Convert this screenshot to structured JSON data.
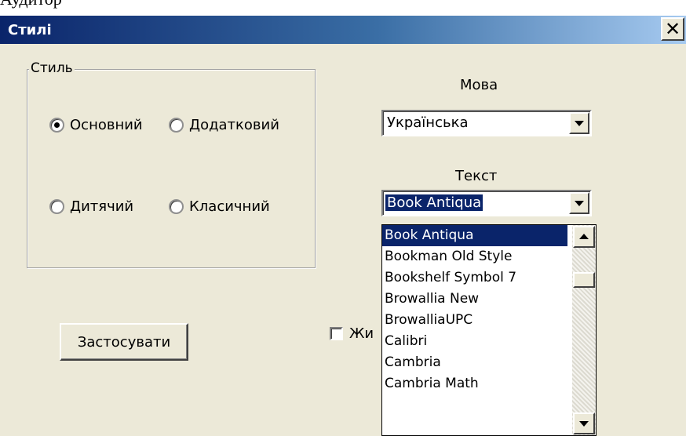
{
  "top_fragment": "Аудитор",
  "window": {
    "title": "Стилі",
    "close_glyph": "✕"
  },
  "style_group": {
    "legend": "Стиль",
    "options": [
      {
        "label": "Основний",
        "checked": true
      },
      {
        "label": "Додатковий",
        "checked": false
      },
      {
        "label": "Дитячий",
        "checked": false
      },
      {
        "label": "Класичний",
        "checked": false
      }
    ]
  },
  "language": {
    "label": "Мова",
    "value": "Українська"
  },
  "text_font": {
    "label": "Текст",
    "value": "Book Antiqua",
    "options": [
      "Book Antiqua",
      "Bookman Old Style",
      "Bookshelf Symbol 7",
      "Browallia New",
      "BrowalliaUPC",
      "Calibri",
      "Cambria",
      "Cambria Math"
    ],
    "selected_index": 0
  },
  "apply_button": {
    "label": "Застосувати"
  },
  "bold_checkbox": {
    "label": "Жи",
    "checked": false
  },
  "colors": {
    "title_bar_start": "#0a246a",
    "title_bar_end": "#a6caf0",
    "dialog_face": "#ece9d8",
    "selection": "#0a246a"
  }
}
